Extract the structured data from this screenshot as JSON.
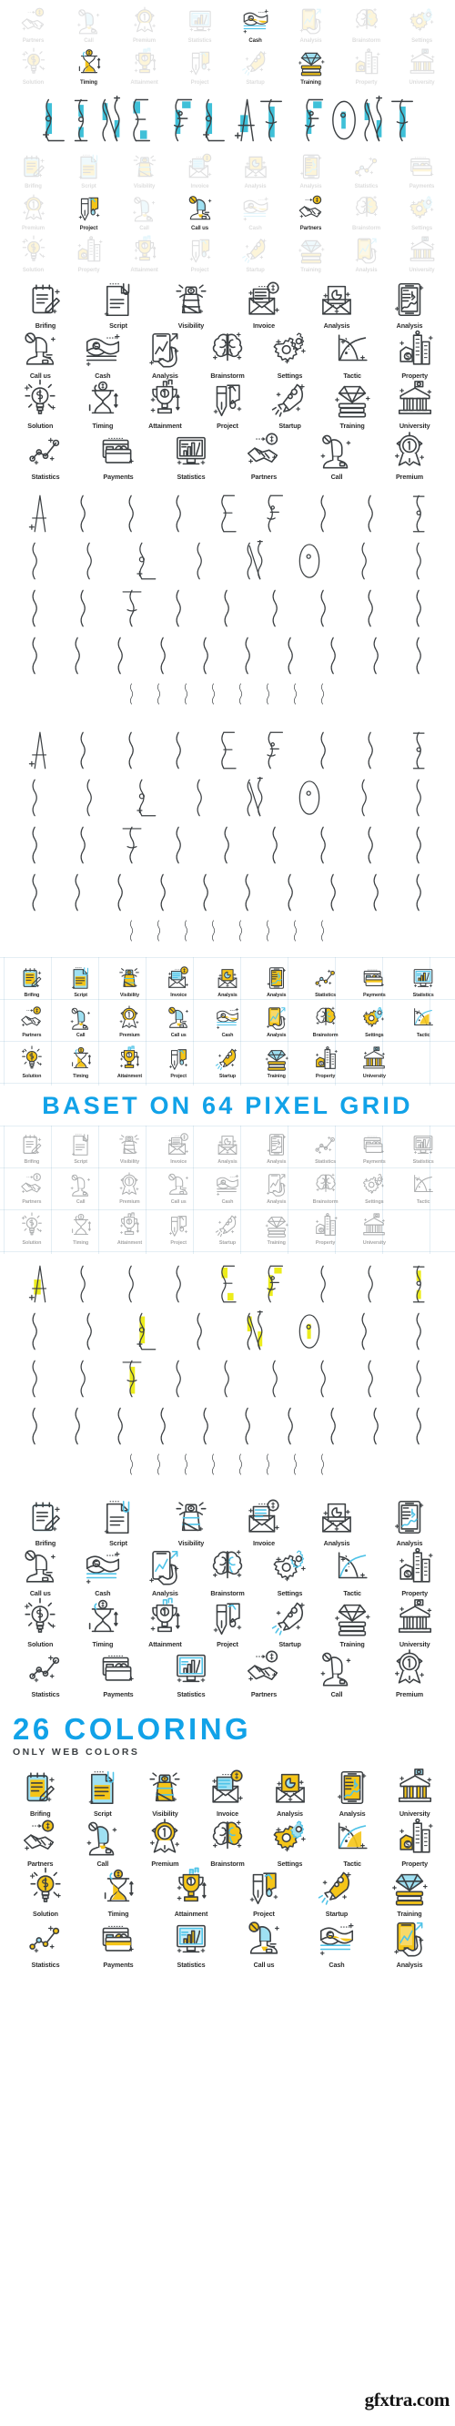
{
  "meta": {
    "product_title": "LINE FLAT FONT",
    "watermark": "gfxtra.com"
  },
  "headings": {
    "pixel_grid": "BASET ON 64 PIXEL GRID",
    "coloring_title": "26 COLORING",
    "coloring_subtitle": "ONLY WEB COLORS"
  },
  "colors": {
    "accent_blue": "#11a2e8",
    "icon_stroke": "#3c4043",
    "accent_cyan": "#4fc3e8",
    "accent_yellow": "#f5c518",
    "hero_teal": "#3fc0d8",
    "alpha_yellow": "#ecec1b",
    "label_text": "#2b2b2b"
  },
  "hero": {
    "title_letters": [
      "L",
      "I",
      "N",
      "E",
      "F",
      "L",
      "A",
      "T",
      "F",
      "O",
      "N",
      "T"
    ],
    "title_words": [
      "LINE",
      "FLAT",
      "FONT"
    ],
    "top_row_1": [
      {
        "label": "Partners",
        "icon": "handshake-coin-icon",
        "highlight": false
      },
      {
        "label": "Call",
        "icon": "headset-person-icon",
        "highlight": false
      },
      {
        "label": "Premium",
        "icon": "award-ribbon-icon",
        "highlight": false
      },
      {
        "label": "Statistics",
        "icon": "monitor-chart-icon",
        "highlight": false
      },
      {
        "label": "Cash",
        "icon": "cash-stack-icon",
        "highlight": true
      },
      {
        "label": "Analysis",
        "icon": "phone-chart-icon",
        "highlight": false
      },
      {
        "label": "Brainstorm",
        "icon": "brain-icon",
        "highlight": false
      },
      {
        "label": "Settings",
        "icon": "gears-icon",
        "highlight": false
      }
    ],
    "top_row_2": [
      {
        "label": "Solution",
        "icon": "bulb-dollar-icon",
        "highlight": false
      },
      {
        "label": "Timing",
        "icon": "hourglass-coin-icon",
        "highlight": true
      },
      {
        "label": "Attainment",
        "icon": "trophy-icon",
        "highlight": false
      },
      {
        "label": "Project",
        "icon": "pen-paint-icon",
        "highlight": false
      },
      {
        "label": "Startup",
        "icon": "rocket-icon",
        "highlight": false
      },
      {
        "label": "Training",
        "icon": "diamond-books-icon",
        "highlight": true
      },
      {
        "label": "Property",
        "icon": "buildings-dollar-icon",
        "highlight": false
      },
      {
        "label": "University",
        "icon": "bank-flag-icon",
        "highlight": false
      }
    ],
    "bottom_row_1": [
      {
        "label": "Brifing",
        "icon": "notepad-pen-icon",
        "highlight": false
      },
      {
        "label": "Script",
        "icon": "document-clip-icon",
        "highlight": false
      },
      {
        "label": "Visibility",
        "icon": "lighthouse-eye-icon",
        "highlight": false
      },
      {
        "label": "Invoice",
        "icon": "envelope-coin-icon",
        "highlight": false
      },
      {
        "label": "Analysis",
        "icon": "envelope-pie-icon",
        "highlight": false
      },
      {
        "label": "Analysis",
        "icon": "tablet-news-icon",
        "highlight": false
      },
      {
        "label": "Statistics",
        "icon": "line-chart-icon",
        "highlight": false
      },
      {
        "label": "Payments",
        "icon": "credit-card-icon",
        "highlight": false
      }
    ],
    "bottom_row_2": [
      {
        "label": "Premium",
        "icon": "award-ribbon-icon",
        "highlight": false
      },
      {
        "label": "Project",
        "icon": "pen-paint-icon",
        "highlight": true
      },
      {
        "label": "Call",
        "icon": "headset-person-icon",
        "highlight": false
      },
      {
        "label": "Call us",
        "icon": "call-us-person-icon",
        "highlight": true
      },
      {
        "label": "Cash",
        "icon": "cash-stack-icon",
        "highlight": false
      },
      {
        "label": "Partners",
        "icon": "handshake-coin-icon",
        "highlight": true
      },
      {
        "label": "Brainstorm",
        "icon": "brain-icon",
        "highlight": false
      },
      {
        "label": "Settings",
        "icon": "gears-icon",
        "highlight": false
      }
    ],
    "bottom_row_3": [
      {
        "label": "Solution",
        "icon": "bulb-dollar-icon",
        "highlight": false
      },
      {
        "label": "Property",
        "icon": "buildings-dollar-icon",
        "highlight": false
      },
      {
        "label": "Attainment",
        "icon": "trophy-icon",
        "highlight": false
      },
      {
        "label": "Project",
        "icon": "pen-paint-icon",
        "highlight": false
      },
      {
        "label": "Startup",
        "icon": "rocket-icon",
        "highlight": false
      },
      {
        "label": "Training",
        "icon": "diamond-books-icon",
        "highlight": false
      },
      {
        "label": "Analysis",
        "icon": "phone-chart-icon",
        "highlight": false
      },
      {
        "label": "University",
        "icon": "bank-flag-icon",
        "highlight": false
      }
    ]
  },
  "icon_sheet_mono": {
    "style": "outline-mono",
    "rows": [
      [
        {
          "label": "Brifing",
          "icon": "notepad-pen-icon"
        },
        {
          "label": "Script",
          "icon": "document-clip-icon"
        },
        {
          "label": "Visibility",
          "icon": "lighthouse-eye-icon"
        },
        {
          "label": "Invoice",
          "icon": "envelope-coin-icon"
        },
        {
          "label": "Analysis",
          "icon": "envelope-pie-icon"
        },
        {
          "label": "Analysis",
          "icon": "tablet-news-icon"
        }
      ],
      [
        {
          "label": "Call us",
          "icon": "call-us-person-icon"
        },
        {
          "label": "Cash",
          "icon": "cash-stack-icon"
        },
        {
          "label": "Analysis",
          "icon": "phone-chart-icon"
        },
        {
          "label": "Brainstorm",
          "icon": "brain-icon"
        },
        {
          "label": "Settings",
          "icon": "gears-icon"
        },
        {
          "label": "Tactic",
          "icon": "tactic-curve-icon"
        },
        {
          "label": "Property",
          "icon": "buildings-dollar-icon"
        }
      ],
      [
        {
          "label": "Solution",
          "icon": "bulb-dollar-icon"
        },
        {
          "label": "Timing",
          "icon": "hourglass-coin-icon"
        },
        {
          "label": "Attainment",
          "icon": "trophy-icon"
        },
        {
          "label": "Project",
          "icon": "pen-paint-icon"
        },
        {
          "label": "Startup",
          "icon": "rocket-icon"
        },
        {
          "label": "Training",
          "icon": "diamond-books-icon"
        },
        {
          "label": "University",
          "icon": "bank-flag-icon"
        }
      ],
      [
        {
          "label": "Statistics",
          "icon": "line-chart-icon"
        },
        {
          "label": "Payments",
          "icon": "credit-card-icon"
        },
        {
          "label": "Statistics",
          "icon": "monitor-chart-icon"
        },
        {
          "label": "Partners",
          "icon": "handshake-coin-icon"
        },
        {
          "label": "Call",
          "icon": "headset-person-icon"
        },
        {
          "label": "Premium",
          "icon": "award-ribbon-icon"
        }
      ]
    ]
  },
  "icon_sheet_cyan": {
    "style": "outline-cyan-accent",
    "rows": [
      [
        {
          "label": "Brifing",
          "icon": "notepad-pen-icon"
        },
        {
          "label": "Script",
          "icon": "document-clip-icon"
        },
        {
          "label": "Visibility",
          "icon": "lighthouse-eye-icon"
        },
        {
          "label": "Invoice",
          "icon": "envelope-coin-icon"
        },
        {
          "label": "Analysis",
          "icon": "envelope-pie-icon"
        },
        {
          "label": "Analysis",
          "icon": "tablet-news-icon"
        }
      ],
      [
        {
          "label": "Call us",
          "icon": "call-us-person-icon"
        },
        {
          "label": "Cash",
          "icon": "cash-stack-icon"
        },
        {
          "label": "Analysis",
          "icon": "phone-chart-icon"
        },
        {
          "label": "Brainstorm",
          "icon": "brain-icon"
        },
        {
          "label": "Settings",
          "icon": "gears-icon"
        },
        {
          "label": "Tactic",
          "icon": "tactic-curve-icon"
        },
        {
          "label": "Property",
          "icon": "buildings-dollar-icon"
        }
      ],
      [
        {
          "label": "Solution",
          "icon": "bulb-dollar-icon"
        },
        {
          "label": "Timing",
          "icon": "hourglass-coin-icon"
        },
        {
          "label": "Attainment",
          "icon": "trophy-icon"
        },
        {
          "label": "Project",
          "icon": "pen-paint-icon"
        },
        {
          "label": "Startup",
          "icon": "rocket-icon"
        },
        {
          "label": "Training",
          "icon": "diamond-books-icon"
        },
        {
          "label": "University",
          "icon": "bank-flag-icon"
        }
      ],
      [
        {
          "label": "Statistics",
          "icon": "line-chart-icon"
        },
        {
          "label": "Payments",
          "icon": "credit-card-icon"
        },
        {
          "label": "Statistics",
          "icon": "monitor-chart-icon"
        },
        {
          "label": "Partners",
          "icon": "handshake-coin-icon"
        },
        {
          "label": "Call",
          "icon": "headset-person-icon"
        },
        {
          "label": "Premium",
          "icon": "award-ribbon-icon"
        }
      ]
    ]
  },
  "pixel_grid_sheet_color": {
    "style": "yellow-cyan-filled",
    "rows": [
      [
        {
          "label": "Brifing",
          "icon": "notepad-pen-icon"
        },
        {
          "label": "Script",
          "icon": "document-clip-icon"
        },
        {
          "label": "Visibility",
          "icon": "lighthouse-eye-icon"
        },
        {
          "label": "Invoice",
          "icon": "envelope-coin-icon"
        },
        {
          "label": "Analysis",
          "icon": "envelope-pie-icon"
        },
        {
          "label": "Analysis",
          "icon": "tablet-news-icon"
        },
        {
          "label": "Statistics",
          "icon": "line-chart-icon"
        },
        {
          "label": "Payments",
          "icon": "credit-card-icon"
        },
        {
          "label": "Statistics",
          "icon": "monitor-chart-icon"
        }
      ],
      [
        {
          "label": "Partners",
          "icon": "handshake-coin-icon"
        },
        {
          "label": "Call",
          "icon": "headset-person-icon"
        },
        {
          "label": "Premium",
          "icon": "award-ribbon-icon"
        },
        {
          "label": "Call us",
          "icon": "call-us-person-icon"
        },
        {
          "label": "Cash",
          "icon": "cash-stack-icon"
        },
        {
          "label": "Analysis",
          "icon": "phone-chart-icon"
        },
        {
          "label": "Brainstorm",
          "icon": "brain-icon"
        },
        {
          "label": "Settings",
          "icon": "gears-icon"
        },
        {
          "label": "Tactic",
          "icon": "tactic-curve-icon"
        }
      ],
      [
        {
          "label": "Solution",
          "icon": "bulb-dollar-icon"
        },
        {
          "label": "Timing",
          "icon": "hourglass-coin-icon"
        },
        {
          "label": "Attainment",
          "icon": "trophy-icon"
        },
        {
          "label": "Project",
          "icon": "pen-paint-icon"
        },
        {
          "label": "Startup",
          "icon": "rocket-icon"
        },
        {
          "label": "Training",
          "icon": "diamond-books-icon"
        },
        {
          "label": "Property",
          "icon": "buildings-dollar-icon"
        },
        {
          "label": "University",
          "icon": "bank-flag-icon"
        }
      ]
    ]
  },
  "pixel_grid_sheet_mono": {
    "style": "outline-faded",
    "rows": [
      [
        {
          "label": "Brifing",
          "icon": "notepad-pen-icon"
        },
        {
          "label": "Script",
          "icon": "document-clip-icon"
        },
        {
          "label": "Visibility",
          "icon": "lighthouse-eye-icon"
        },
        {
          "label": "Invoice",
          "icon": "envelope-coin-icon"
        },
        {
          "label": "Analysis",
          "icon": "envelope-pie-icon"
        },
        {
          "label": "Analysis",
          "icon": "tablet-news-icon"
        },
        {
          "label": "Statistics",
          "icon": "line-chart-icon"
        },
        {
          "label": "Payments",
          "icon": "credit-card-icon"
        },
        {
          "label": "Statistics",
          "icon": "monitor-chart-icon"
        }
      ],
      [
        {
          "label": "Partners",
          "icon": "handshake-coin-icon"
        },
        {
          "label": "Call",
          "icon": "headset-person-icon"
        },
        {
          "label": "Premium",
          "icon": "award-ribbon-icon"
        },
        {
          "label": "Call us",
          "icon": "call-us-person-icon"
        },
        {
          "label": "Cash",
          "icon": "cash-stack-icon"
        },
        {
          "label": "Analysis",
          "icon": "phone-chart-icon"
        },
        {
          "label": "Brainstorm",
          "icon": "brain-icon"
        },
        {
          "label": "Settings",
          "icon": "gears-icon"
        },
        {
          "label": "Tactic",
          "icon": "tactic-curve-icon"
        }
      ],
      [
        {
          "label": "Solution",
          "icon": "bulb-dollar-icon"
        },
        {
          "label": "Timing",
          "icon": "hourglass-coin-icon"
        },
        {
          "label": "Attainment",
          "icon": "trophy-icon"
        },
        {
          "label": "Project",
          "icon": "pen-paint-icon"
        },
        {
          "label": "Startup",
          "icon": "rocket-icon"
        },
        {
          "label": "Training",
          "icon": "diamond-books-icon"
        },
        {
          "label": "Property",
          "icon": "buildings-dollar-icon"
        },
        {
          "label": "University",
          "icon": "bank-flag-icon"
        }
      ]
    ]
  },
  "coloring_sheet": {
    "style": "yellow-cyan-filled",
    "rows": [
      [
        {
          "label": "Brifing",
          "icon": "notepad-pen-icon"
        },
        {
          "label": "Script",
          "icon": "document-clip-icon"
        },
        {
          "label": "Visibility",
          "icon": "lighthouse-eye-icon"
        },
        {
          "label": "Invoice",
          "icon": "envelope-coin-icon"
        },
        {
          "label": "Analysis",
          "icon": "envelope-pie-icon"
        },
        {
          "label": "Analysis",
          "icon": "tablet-news-icon"
        },
        {
          "label": "University",
          "icon": "bank-flag-icon"
        }
      ],
      [
        {
          "label": "Partners",
          "icon": "handshake-coin-icon"
        },
        {
          "label": "Call",
          "icon": "headset-person-icon"
        },
        {
          "label": "Premium",
          "icon": "award-ribbon-icon"
        },
        {
          "label": "Brainstorm",
          "icon": "brain-icon"
        },
        {
          "label": "Settings",
          "icon": "gears-icon"
        },
        {
          "label": "Tactic",
          "icon": "tactic-curve-icon"
        },
        {
          "label": "Property",
          "icon": "buildings-dollar-icon"
        }
      ],
      [
        {
          "label": "Solution",
          "icon": "bulb-dollar-icon"
        },
        {
          "label": "Timing",
          "icon": "hourglass-coin-icon"
        },
        {
          "label": "Attainment",
          "icon": "trophy-icon"
        },
        {
          "label": "Project",
          "icon": "pen-paint-icon"
        },
        {
          "label": "Startup",
          "icon": "rocket-icon"
        },
        {
          "label": "Training",
          "icon": "diamond-books-icon"
        }
      ],
      [
        {
          "label": "Statistics",
          "icon": "line-chart-icon"
        },
        {
          "label": "Payments",
          "icon": "credit-card-icon"
        },
        {
          "label": "Statistics",
          "icon": "monitor-chart-icon"
        },
        {
          "label": "Call us",
          "icon": "call-us-person-icon"
        },
        {
          "label": "Cash",
          "icon": "cash-stack-icon"
        },
        {
          "label": "Analysis",
          "icon": "phone-chart-icon"
        }
      ]
    ]
  },
  "alphabets": {
    "rows": {
      "r1": [
        "A",
        "B",
        "C",
        "D",
        "E",
        "F",
        "G",
        "H",
        "I"
      ],
      "r2": [
        "J",
        "K",
        "L",
        "M",
        "N",
        "O",
        "P",
        "Q"
      ],
      "r3": [
        "R",
        "S",
        "T",
        "U",
        "V",
        "W",
        "X",
        "Y",
        "Z"
      ],
      "r4": [
        "0",
        "1",
        "2",
        "3",
        "4",
        "5",
        "6",
        "7",
        "8",
        "9"
      ],
      "r5": [
        "?",
        ",",
        "!",
        "&",
        "(",
        ")",
        ";",
        ":"
      ]
    },
    "variants": [
      {
        "name": "outline-plain",
        "fill": "none"
      },
      {
        "name": "outline-plain-duplicate",
        "fill": "none"
      },
      {
        "name": "outline-yellow-highlight",
        "fill": "#ecec1b"
      }
    ]
  }
}
